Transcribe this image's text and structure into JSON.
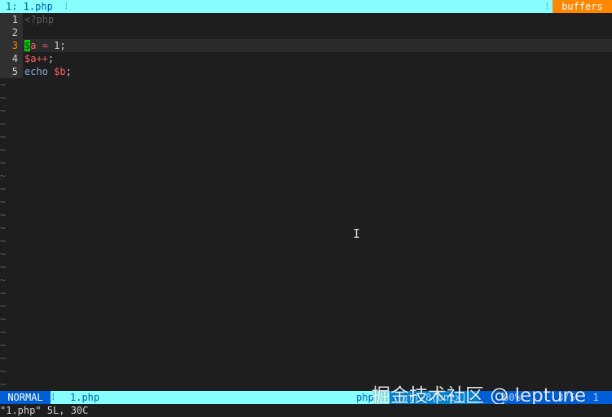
{
  "tabline": {
    "active_tab": "1: 1.php",
    "right_label": "buffers",
    "separator_glyph": "⁞"
  },
  "editor": {
    "lines": [
      {
        "num": "1",
        "tokens": [
          {
            "t": "<?php",
            "c": "tag"
          }
        ]
      },
      {
        "num": "2",
        "tokens": []
      },
      {
        "num": "3",
        "tokens": [
          {
            "t": "$",
            "c": "cursor"
          },
          {
            "t": "a",
            "c": "var"
          },
          {
            "t": " = ",
            "c": "op"
          },
          {
            "t": "1",
            "c": "num"
          },
          {
            "t": ";",
            "c": "plain"
          }
        ]
      },
      {
        "num": "4",
        "tokens": [
          {
            "t": "$a",
            "c": "var"
          },
          {
            "t": "++",
            "c": "op"
          },
          {
            "t": ";",
            "c": "plain"
          }
        ]
      },
      {
        "num": "5",
        "tokens": [
          {
            "t": "echo",
            "c": "kw"
          },
          {
            "t": " ",
            "c": "plain"
          },
          {
            "t": "$b",
            "c": "var"
          },
          {
            "t": ";",
            "c": "plain"
          }
        ]
      }
    ],
    "cursor_line": "3",
    "empty_marker": "~"
  },
  "statusline": {
    "mode": "NORMAL",
    "filename": "1.php",
    "filetype": "php",
    "encoding": "utf-8[unix]",
    "percent": "60%",
    "position": "3/5 :  1"
  },
  "watermark": "掘金技术社区 @ leptune",
  "cmdline": "\"1.php\" 5L, 30C",
  "colors": {
    "background": "#1e1e1e",
    "tabline_active": "#87ffff",
    "buffers_badge": "#ff8700",
    "mode_bg": "#005fd7",
    "cursor": "#00d700"
  }
}
